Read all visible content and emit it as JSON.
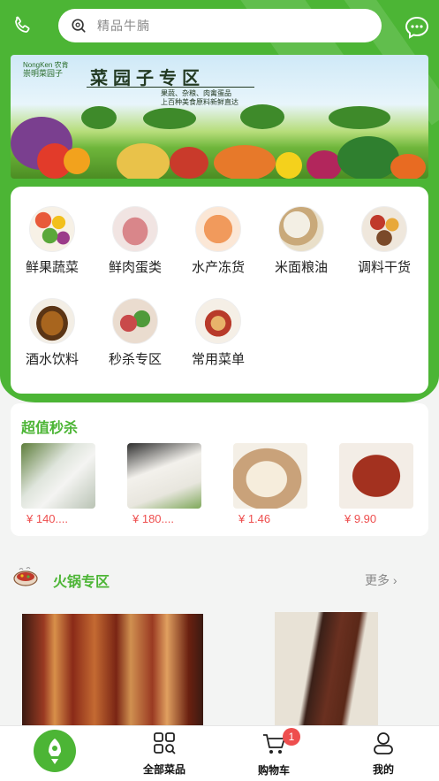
{
  "search": {
    "placeholder": "精品牛腩"
  },
  "banner": {
    "brand_small": "NongKen 农肯",
    "brand_name": "崇明菜园子",
    "title": "菜园子专区",
    "sub1": "果蔬、杂粮、肉禽蛋品",
    "sub2": "上百种美食原料新鲜直达"
  },
  "categories": [
    {
      "label": "鲜果蔬菜",
      "icon": "vegetables-image"
    },
    {
      "label": "鲜肉蛋类",
      "icon": "meat-image"
    },
    {
      "label": "水产冻货",
      "icon": "seafood-image"
    },
    {
      "label": "米面粮油",
      "icon": "rice-image"
    },
    {
      "label": "调料干货",
      "icon": "spices-image"
    },
    {
      "label": "酒水饮料",
      "icon": "drinks-image"
    },
    {
      "label": "秒杀专区",
      "icon": "flash-sale-image"
    },
    {
      "label": "常用菜单",
      "icon": "menu-image"
    }
  ],
  "flash_sale": {
    "title": "超值秒杀",
    "products": [
      {
        "price": "¥ 140...."
      },
      {
        "price": "¥ 180...."
      },
      {
        "price": "¥ 1.46"
      },
      {
        "price": "¥ 9.90"
      }
    ]
  },
  "hotpot": {
    "title": "火锅专区",
    "more": "更多"
  },
  "tabbar": {
    "all": "全部菜品",
    "cart": "购物车",
    "cart_badge": "1",
    "mine": "我的"
  },
  "colors": {
    "brand_green": "#4cb535",
    "price_red": "#ee4e4e"
  }
}
